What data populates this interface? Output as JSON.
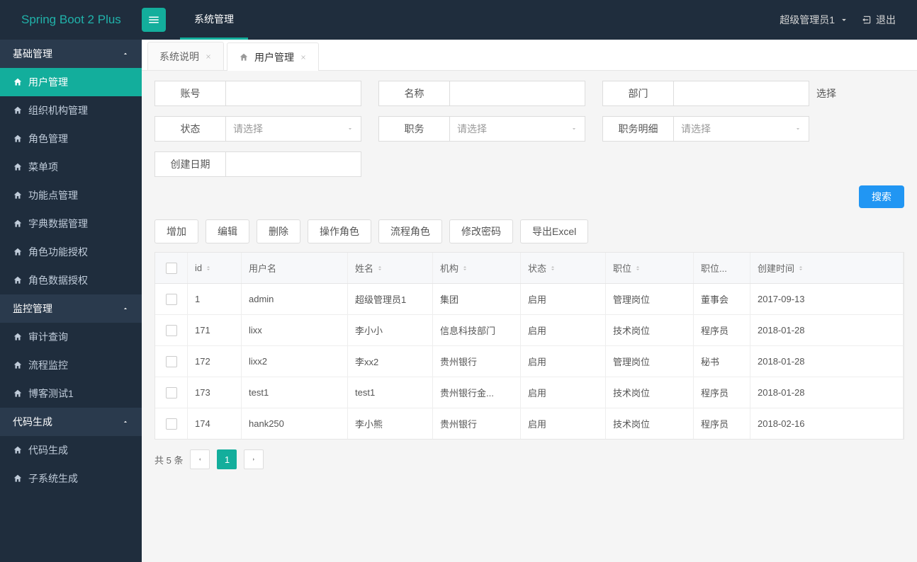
{
  "brand": "Spring Boot 2 Plus",
  "topNav": {
    "item0": "系统管理"
  },
  "header": {
    "userName": "超级管理员1",
    "logout": "退出"
  },
  "sidebar": {
    "groups": [
      {
        "title": "基础管理",
        "items": [
          "用户管理",
          "组织机构管理",
          "角色管理",
          "菜单项",
          "功能点管理",
          "字典数据管理",
          "角色功能授权",
          "角色数据授权"
        ]
      },
      {
        "title": "监控管理",
        "items": [
          "审计查询",
          "流程监控",
          "博客测试1"
        ]
      },
      {
        "title": "代码生成",
        "items": [
          "代码生成",
          "子系统生成"
        ]
      }
    ]
  },
  "tabs": [
    {
      "label": "系统说明"
    },
    {
      "label": "用户管理",
      "active": true
    }
  ],
  "filters": {
    "account": "账号",
    "name": "名称",
    "dept": "部门",
    "deptExtra": "选择",
    "status": "状态",
    "job": "职务",
    "jobDetail": "职务明细",
    "createDate": "创建日期",
    "placeholderSelect": "请选择"
  },
  "buttons": {
    "search": "搜索",
    "add": "增加",
    "edit": "编辑",
    "delete": "删除",
    "opRole": "操作角色",
    "flowRole": "流程角色",
    "changePwd": "修改密码",
    "export": "导出Excel"
  },
  "table": {
    "headers": {
      "id": "id",
      "user": "用户名",
      "name": "姓名",
      "org": "机构",
      "status": "状态",
      "pos": "职位",
      "posd": "职位...",
      "date": "创建时间"
    },
    "rows": [
      {
        "id": "1",
        "user": "admin",
        "name": "超级管理员1",
        "org": "集团",
        "status": "启用",
        "pos": "管理岗位",
        "posd": "董事会",
        "date": "2017-09-13"
      },
      {
        "id": "171",
        "user": "lixx",
        "name": "李小小",
        "org": "信息科技部门",
        "status": "启用",
        "pos": "技术岗位",
        "posd": "程序员",
        "date": "2018-01-28"
      },
      {
        "id": "172",
        "user": "lixx2",
        "name": "李xx2",
        "org": "贵州银行",
        "status": "启用",
        "pos": "管理岗位",
        "posd": "秘书",
        "date": "2018-01-28"
      },
      {
        "id": "173",
        "user": "test1",
        "name": "test1",
        "org": "贵州银行金...",
        "status": "启用",
        "pos": "技术岗位",
        "posd": "程序员",
        "date": "2018-01-28"
      },
      {
        "id": "174",
        "user": "hank250",
        "name": "李小熊",
        "org": "贵州银行",
        "status": "启用",
        "pos": "技术岗位",
        "posd": "程序员",
        "date": "2018-02-16"
      }
    ]
  },
  "pagination": {
    "total": "共 5 条",
    "page": "1"
  }
}
